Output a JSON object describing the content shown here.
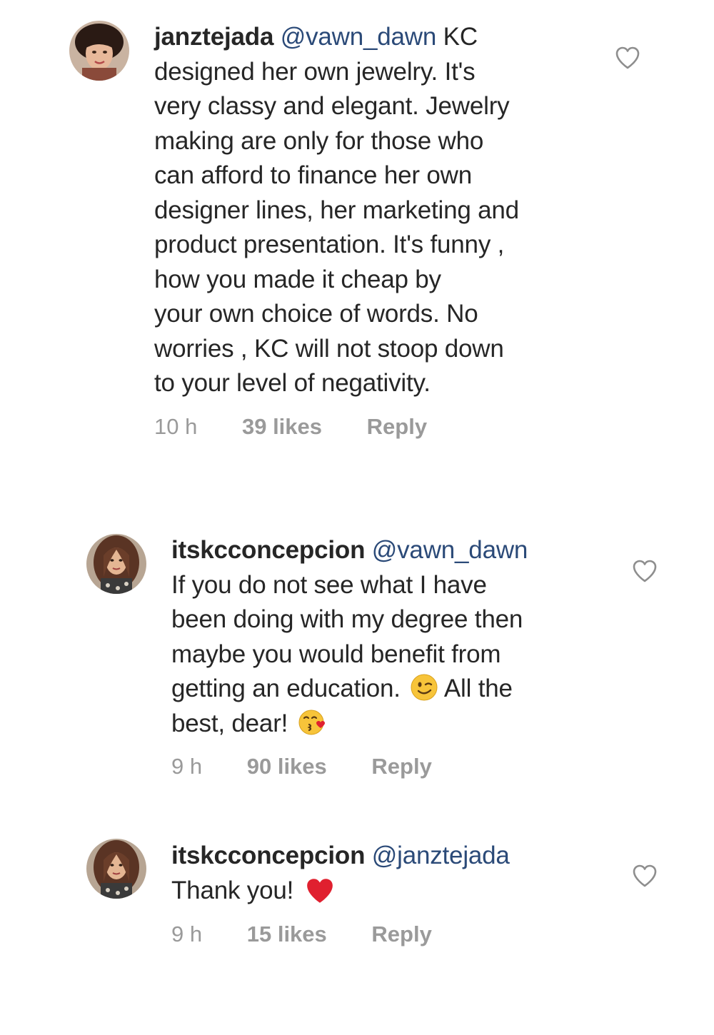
{
  "comments": [
    {
      "username": "janztejada",
      "mention": "@vawn_dawn",
      "first_line_rest": "KC",
      "lines": [
        "designed  her own jewelry.  It's",
        "very classy and elegant. Jewelry",
        "making are only for those who",
        "can afford to finance her own",
        "designer lines, her marketing and",
        "product presentation.  It's funny ,",
        "how you made it cheap by",
        "your own choice of words.  No",
        "worries , KC will not stoop down",
        "to your level of negativity."
      ],
      "time": "10 h",
      "likes": "39 likes",
      "reply": "Reply"
    },
    {
      "username": "itskcconcepcion",
      "mention": "@vawn_dawn",
      "lines": [
        "If you do not see what I have",
        "been doing with my degree then",
        "maybe you would benefit from"
      ],
      "line4_a": "getting an education.",
      "line4_b": "All the",
      "line5": "best, dear!",
      "emoji_wink": "winking-face-emoji",
      "emoji_kiss": "face-blowing-kiss-emoji",
      "time": "9 h",
      "likes": "90 likes",
      "reply": "Reply"
    },
    {
      "username": "itskcconcepcion",
      "mention": "@janztejada",
      "text": "Thank you!",
      "emoji_heart": "red-heart-emoji",
      "time": "9 h",
      "likes": "15 likes",
      "reply": "Reply"
    }
  ],
  "colors": {
    "text": "#262626",
    "mention": "#2b4a78",
    "meta": "#9a9a9a",
    "heart_outline": "#8e8e8e",
    "red_heart": "#e0202f",
    "emoji_yellow": "#f7c43a"
  },
  "icons": {
    "like": "heart-outline-icon"
  }
}
